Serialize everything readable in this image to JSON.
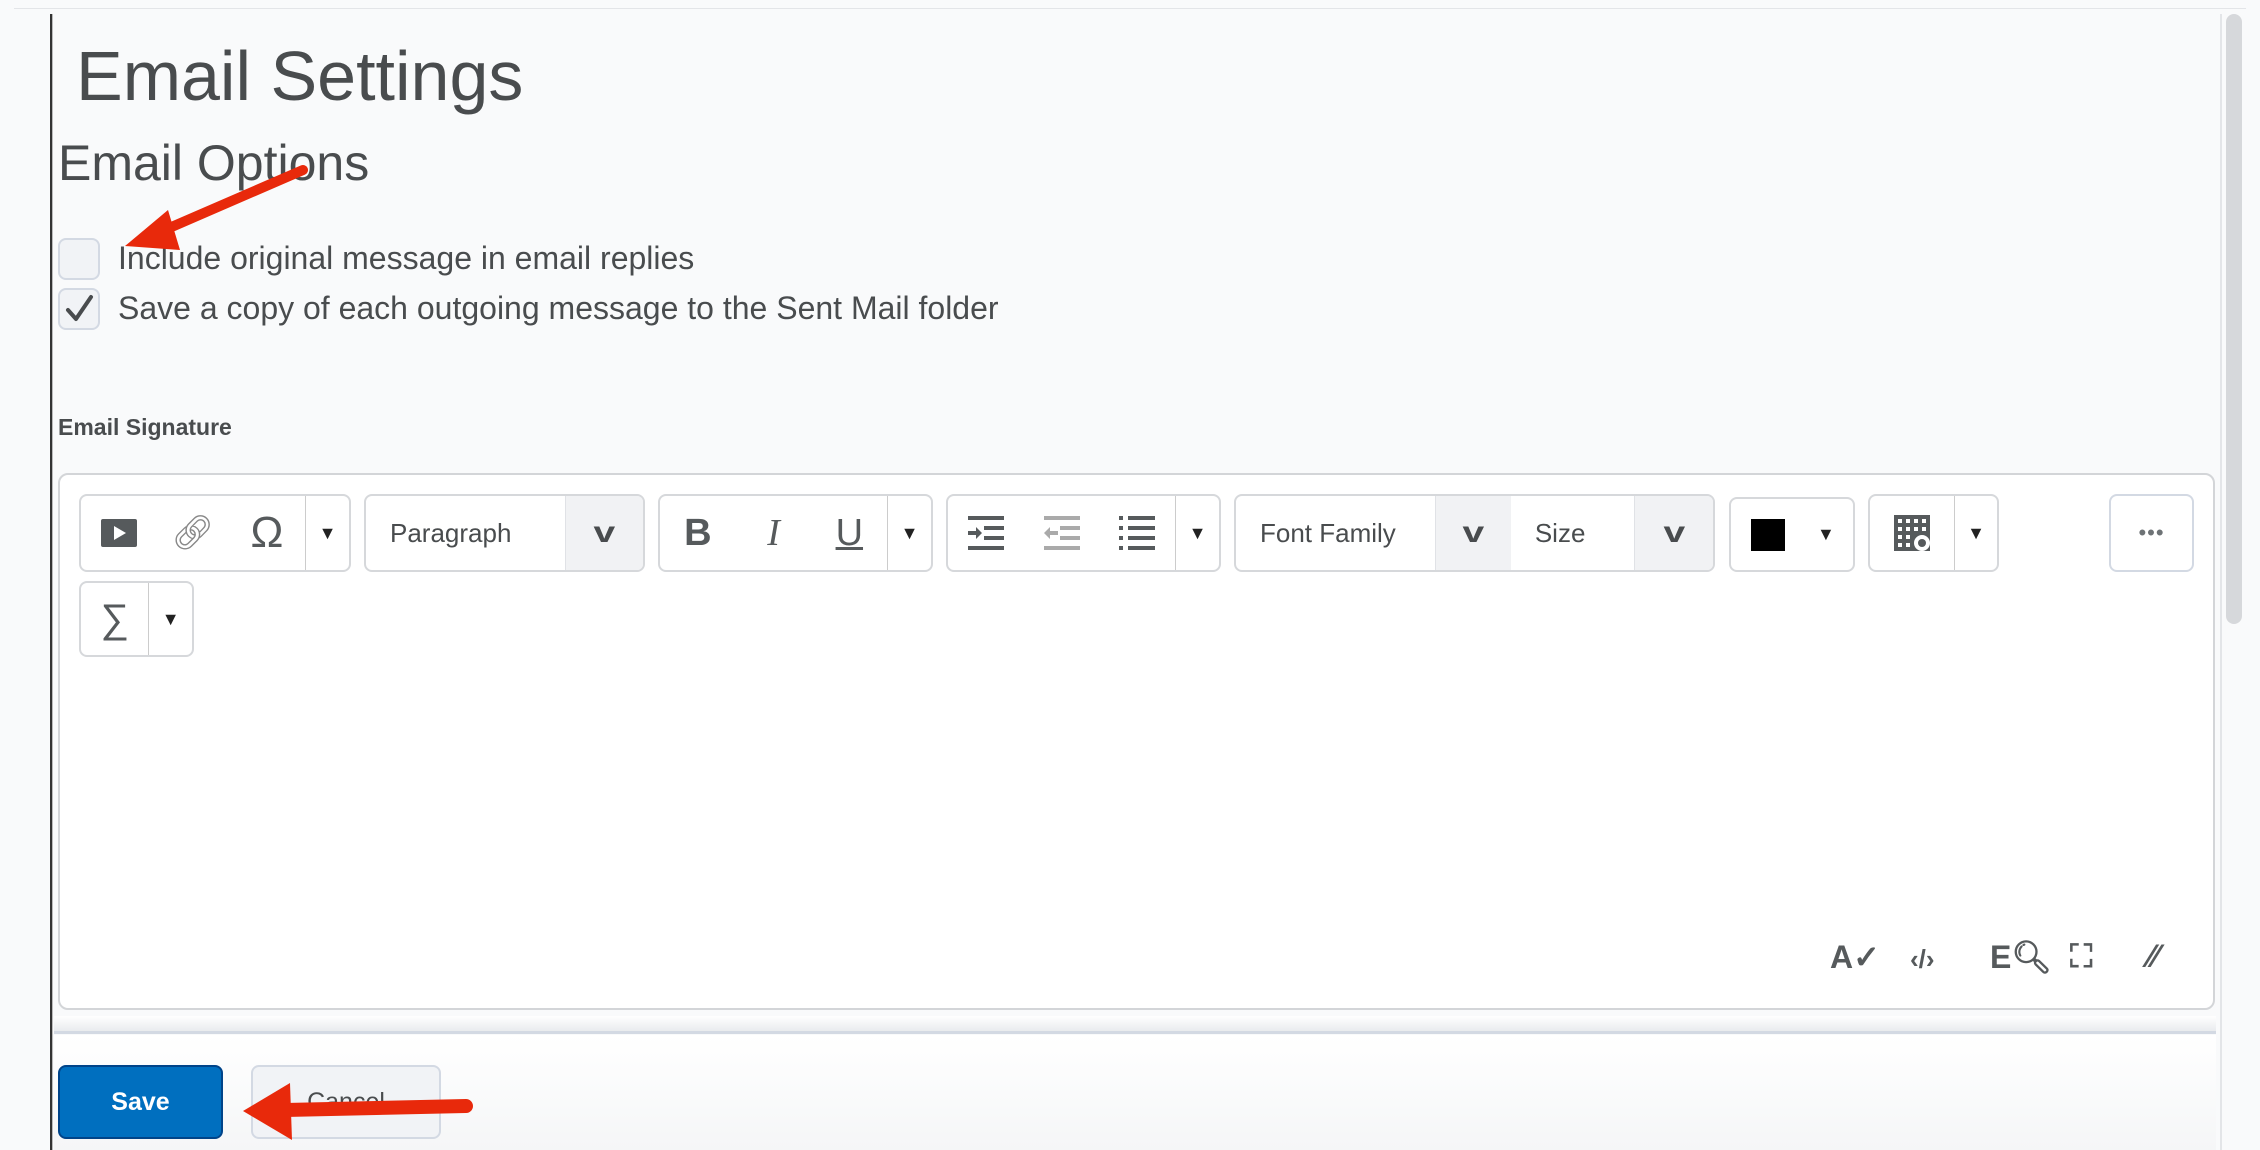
{
  "page": {
    "title": "Email Settings",
    "section_title": "Email Options"
  },
  "options": [
    {
      "label": "Include original message in email replies",
      "checked": false
    },
    {
      "label": "Save a copy of each outgoing message to the Sent Mail folder",
      "checked": true
    }
  ],
  "signature": {
    "label": "Email Signature",
    "toolbar": {
      "block_format": "Paragraph",
      "font_family": "Font Family",
      "font_size": "Size",
      "bold": "B",
      "italic": "I",
      "underline": "U",
      "more": "•••",
      "color": "#000000"
    }
  },
  "actions": {
    "save": "Save",
    "cancel": "Cancel"
  },
  "colors": {
    "primary": "#006fbf",
    "annotation_arrow": "#ff2a00"
  }
}
